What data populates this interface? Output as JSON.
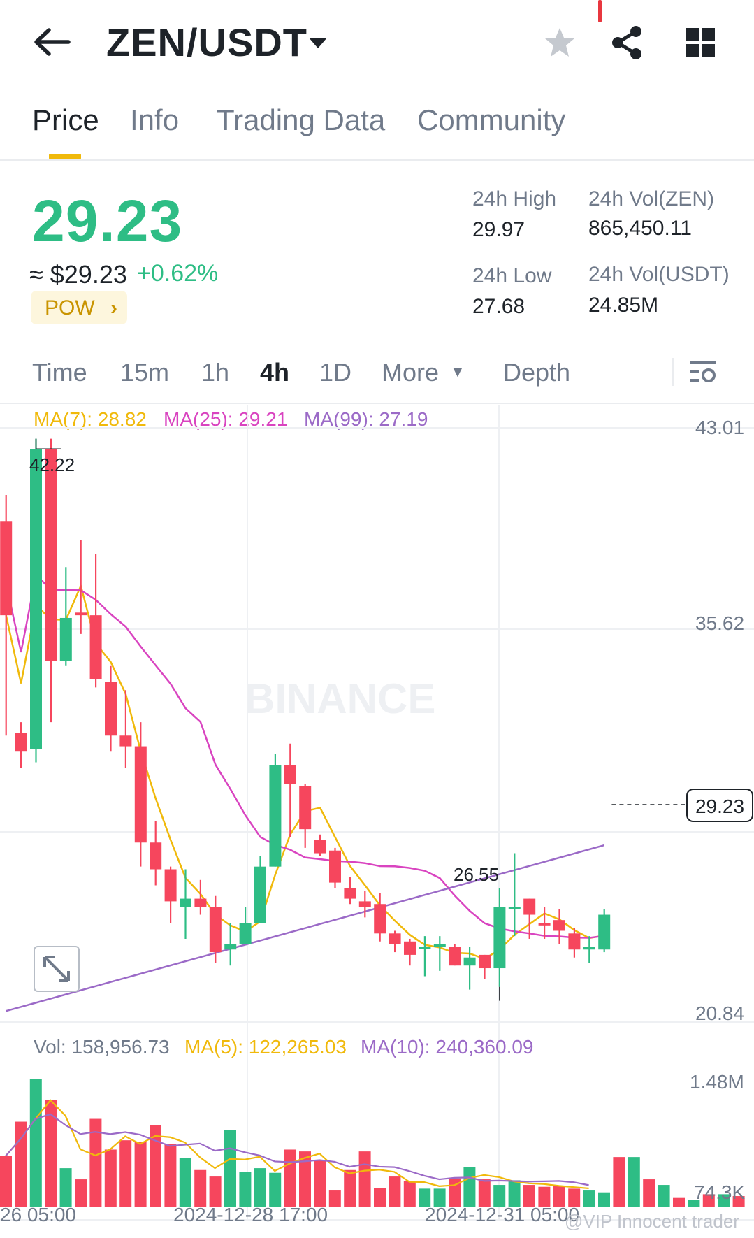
{
  "header": {
    "pair": "ZEN/USDT",
    "back_icon": "arrow-left-icon",
    "star_icon": "star-icon",
    "share_icon": "share-icon",
    "grid_icon": "grid-icon"
  },
  "tabs": [
    {
      "label": "Price",
      "active": true
    },
    {
      "label": "Info"
    },
    {
      "label": "Trading Data"
    },
    {
      "label": "Community"
    }
  ],
  "ticker": {
    "price": "29.23",
    "fiat": "≈ $29.23",
    "change": "+0.62%",
    "tag": "POW",
    "high_label": "24h High",
    "high": "29.97",
    "low_label": "24h Low",
    "low": "27.68",
    "vol_base_label": "24h Vol(ZEN)",
    "vol_base": "865,450.11",
    "vol_quote_label": "24h Vol(USDT)",
    "vol_quote": "24.85M"
  },
  "timeframes": {
    "time": "Time",
    "m15": "15m",
    "h1": "1h",
    "h4": "4h",
    "d1": "1D",
    "more": "More",
    "depth": "Depth",
    "active": "4h"
  },
  "chart": {
    "ma7": "MA(7): 28.82",
    "ma25": "MA(25): 29.21",
    "ma99": "MA(99): 27.19",
    "axis_top": "43.01",
    "axis_mid": "35.62",
    "axis_low": "20.84",
    "high_marker": "42.22",
    "low_marker": "26.55",
    "current": "29.23",
    "vol_label": "Vol: 158,956.73",
    "vol_ma5": "MA(5): 122,265.03",
    "vol_ma10": "MA(10): 240,360.09",
    "vol_axis_top": "1.48M",
    "vol_axis_low": "74.3K",
    "date1": "26 05:00",
    "date2": "2024-12-28 17:00",
    "date3": "2024-12-31 05:00",
    "watermark": "@VIP Innocent trader",
    "brand_watermark": "BINANCE"
  },
  "colors": {
    "up": "#2ebd85",
    "down": "#f6465d",
    "ma7": "#f0b90b",
    "ma25": "#d944c0",
    "ma99": "#9b6ac7",
    "accent": "#f0b90b"
  },
  "chart_data": {
    "type": "candlestick",
    "y_range": [
      20.84,
      43.01
    ],
    "candles": [
      [
        39.5,
        36.0,
        40.5,
        31.5
      ],
      [
        31.6,
        30.9,
        32.0,
        30.3
      ],
      [
        31.0,
        42.2,
        42.6,
        30.5
      ],
      [
        42.2,
        34.3,
        42.6,
        32.0
      ],
      [
        34.3,
        35.9,
        37.8,
        34.1
      ],
      [
        36.1,
        36.0,
        38.8,
        35.3
      ],
      [
        36.0,
        33.6,
        38.3,
        33.3
      ],
      [
        33.5,
        31.5,
        34.1,
        30.9
      ],
      [
        31.5,
        31.1,
        33.2,
        30.3
      ],
      [
        31.1,
        27.5,
        32.0,
        26.6
      ],
      [
        27.5,
        26.5,
        28.3,
        25.9
      ],
      [
        26.5,
        25.3,
        26.6,
        24.5
      ],
      [
        25.1,
        25.4,
        26.5,
        23.9
      ],
      [
        25.4,
        25.1,
        26.1,
        24.8
      ],
      [
        25.1,
        23.4,
        25.5,
        23.0
      ],
      [
        23.5,
        23.7,
        24.5,
        22.9
      ],
      [
        23.7,
        24.5,
        25.1,
        23.8
      ],
      [
        24.5,
        26.6,
        27.0,
        24.5
      ],
      [
        26.6,
        30.4,
        30.8,
        26.6
      ],
      [
        30.4,
        29.7,
        31.2,
        27.7
      ],
      [
        29.6,
        28.0,
        29.7,
        27.3
      ],
      [
        27.6,
        27.1,
        27.8,
        27.0
      ],
      [
        27.2,
        26.0,
        27.3,
        25.8
      ],
      [
        25.8,
        25.4,
        26.2,
        25.2
      ],
      [
        25.3,
        25.1,
        25.7,
        24.7
      ],
      [
        25.2,
        24.1,
        25.6,
        23.8
      ],
      [
        24.1,
        23.7,
        24.2,
        23.4
      ],
      [
        23.8,
        23.3,
        23.9,
        22.9
      ],
      [
        23.6,
        23.6,
        24.0,
        22.5
      ],
      [
        23.6,
        23.7,
        24.0,
        22.7
      ],
      [
        23.6,
        22.9,
        23.7,
        22.9
      ],
      [
        22.9,
        23.2,
        23.6,
        22.0
      ],
      [
        23.3,
        22.8,
        23.3,
        22.4
      ],
      [
        22.8,
        25.1,
        25.8,
        22.1
      ],
      [
        25.1,
        25.1,
        27.1,
        24.0
      ],
      [
        25.4,
        24.8,
        25.4,
        23.9
      ],
      [
        24.5,
        24.4,
        25.1,
        23.9
      ],
      [
        24.6,
        24.2,
        25.0,
        23.7
      ],
      [
        24.1,
        23.5,
        24.3,
        23.2
      ],
      [
        23.5,
        23.6,
        24.0,
        23.0
      ],
      [
        23.5,
        24.8,
        25.0,
        23.4
      ]
    ],
    "volumes": [
      0.55,
      0.92,
      1.38,
      1.15,
      0.42,
      0.3,
      0.95,
      0.62,
      0.72,
      0.7,
      0.88,
      0.68,
      0.53,
      0.4,
      0.33,
      0.83,
      0.38,
      0.42,
      0.37,
      0.62,
      0.6,
      0.51,
      0.18,
      0.4,
      0.6,
      0.21,
      0.33,
      0.28,
      0.2,
      0.2,
      0.31,
      0.43,
      0.3,
      0.24,
      0.29,
      0.24,
      0.22,
      0.23,
      0.2,
      0.18,
      0.16,
      0.54,
      0.54,
      0.3,
      0.24,
      0.1,
      0.08,
      0.14,
      0.14,
      0.12
    ]
  }
}
